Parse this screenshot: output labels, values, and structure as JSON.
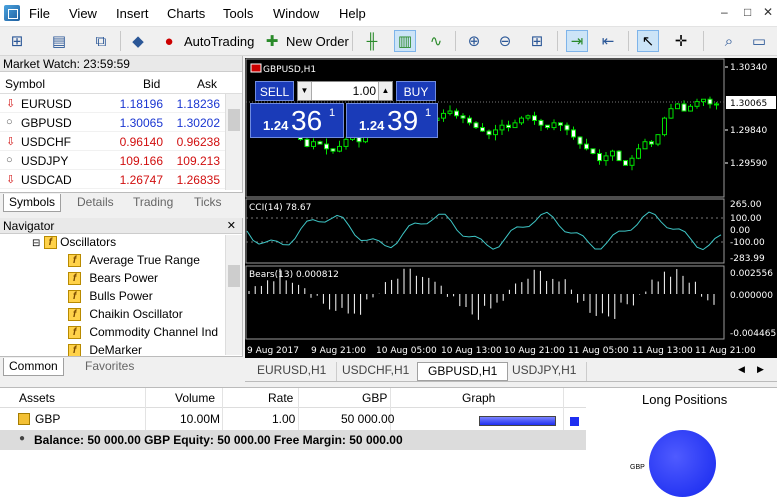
{
  "menu": [
    "File",
    "View",
    "Insert",
    "Charts",
    "Tools",
    "Window",
    "Help"
  ],
  "window_controls": [
    "–",
    "□",
    "✕"
  ],
  "toolbar": {
    "autotrading_label": "AutoTrading",
    "new_order_label": "New Order"
  },
  "market_watch": {
    "title": "Market Watch: 23:59:59",
    "columns": [
      "Symbol",
      "Bid",
      "Ask"
    ],
    "rows": [
      {
        "symbol": "EURUSD",
        "bid": "1.18196",
        "ask": "1.18236",
        "color": "blue",
        "icon": "down-arrow-icon"
      },
      {
        "symbol": "GBPUSD",
        "bid": "1.30065",
        "ask": "1.30202",
        "color": "blue",
        "icon": "circle-icon"
      },
      {
        "symbol": "USDCHF",
        "bid": "0.96140",
        "ask": "0.96238",
        "color": "red",
        "icon": "down-arrow-icon"
      },
      {
        "symbol": "USDJPY",
        "bid": "109.166",
        "ask": "109.213",
        "color": "red",
        "icon": "circle-icon"
      },
      {
        "symbol": "USDCAD",
        "bid": "1.26747",
        "ask": "1.26835",
        "color": "red",
        "icon": "down-arrow-icon"
      }
    ],
    "tabs": [
      "Symbols",
      "Details",
      "Trading",
      "Ticks"
    ]
  },
  "navigator": {
    "title": "Navigator",
    "folder": "Oscillators",
    "items": [
      "Average True Range",
      "Bears Power",
      "Bulls Power",
      "Chaikin Oscillator",
      "Commodity Channel Ind",
      "DeMarker"
    ],
    "tabs": [
      "Common",
      "Favorites"
    ]
  },
  "chart": {
    "symbol_label": "GBPUSD,H1",
    "price_levels": [
      "1.30340",
      "1.29840",
      "1.29590"
    ],
    "current_price": "1.30065",
    "cci_label": "CCI(14) 78.67",
    "cci_levels": [
      "265.00",
      "100.00",
      "0.00",
      "-100.00",
      "-283.99"
    ],
    "bears_label": "Bears(13) 0.000812",
    "bears_levels": [
      "0.002556",
      "0.000000",
      "-0.004465"
    ],
    "time_labels": [
      "9 Aug 2017",
      "9 Aug 21:00",
      "10 Aug 05:00",
      "10 Aug 13:00",
      "10 Aug 21:00",
      "11 Aug 05:00",
      "11 Aug 13:00",
      "11 Aug 21:00"
    ]
  },
  "trade_panel": {
    "sell_label": "SELL",
    "buy_label": "BUY",
    "lot": "1.00",
    "sell_prefix": "1.24",
    "sell_big": "36",
    "sell_sup": "1",
    "buy_prefix": "1.24",
    "buy_big": "39",
    "buy_sup": "1"
  },
  "chart_tabs": [
    "EURUSD,H1",
    "USDCHF,H1",
    "GBPUSD,H1",
    "USDJPY,H1"
  ],
  "terminal": {
    "columns": [
      "Assets",
      "Volume",
      "Rate",
      "GBP",
      "Graph"
    ],
    "row": {
      "asset": "GBP",
      "volume": "10.00M",
      "rate": "1.00",
      "gbp": "50 000.00"
    },
    "balance": "Balance: 50 000.00 GBP  Equity: 50 000.00  Free Margin: 50 000.00",
    "long_positions": "Long Positions",
    "pie_label": "GBP"
  }
}
